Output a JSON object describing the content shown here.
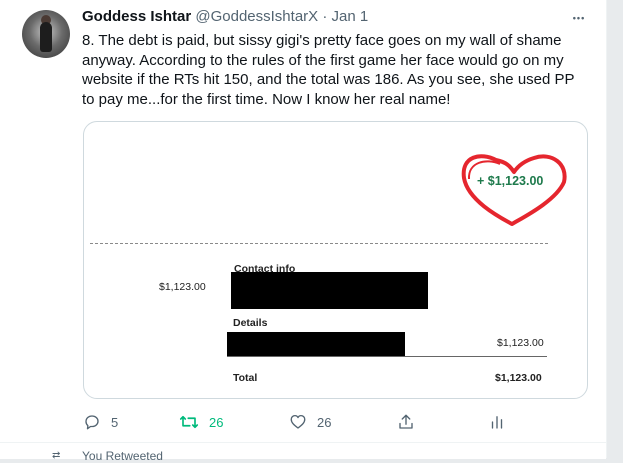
{
  "tweet": {
    "display_name": "Goddess Ishtar",
    "handle": "@GoddessIshtarX",
    "separator": "·",
    "date": "Jan 1",
    "more_label": "•••",
    "text": "8. The debt is paid, but sissy gigi's pretty face goes on my wall of shame anyway. According to the rules of the first game her face would go on my website if the RTs hit 150, and the total was 186. As you see, she used PP to pay me...for the first time. Now I know her real name!"
  },
  "receipt": {
    "received_amount": "+ $1,123.00",
    "left_amount": "$1,123.00",
    "contact_label": "Contact info",
    "details_label": "Details",
    "details_amount": "$1,123.00",
    "total_label": "Total",
    "total_amount": "$1,123.00"
  },
  "actions": {
    "replies": "5",
    "retweets": "26",
    "likes": "26"
  },
  "bottom": {
    "text": "You Retweeted"
  },
  "colors": {
    "retweet_active": "#00ba7c",
    "amount_green": "#1e7a4c",
    "heart_red": "#e5262e",
    "muted": "#536471"
  }
}
